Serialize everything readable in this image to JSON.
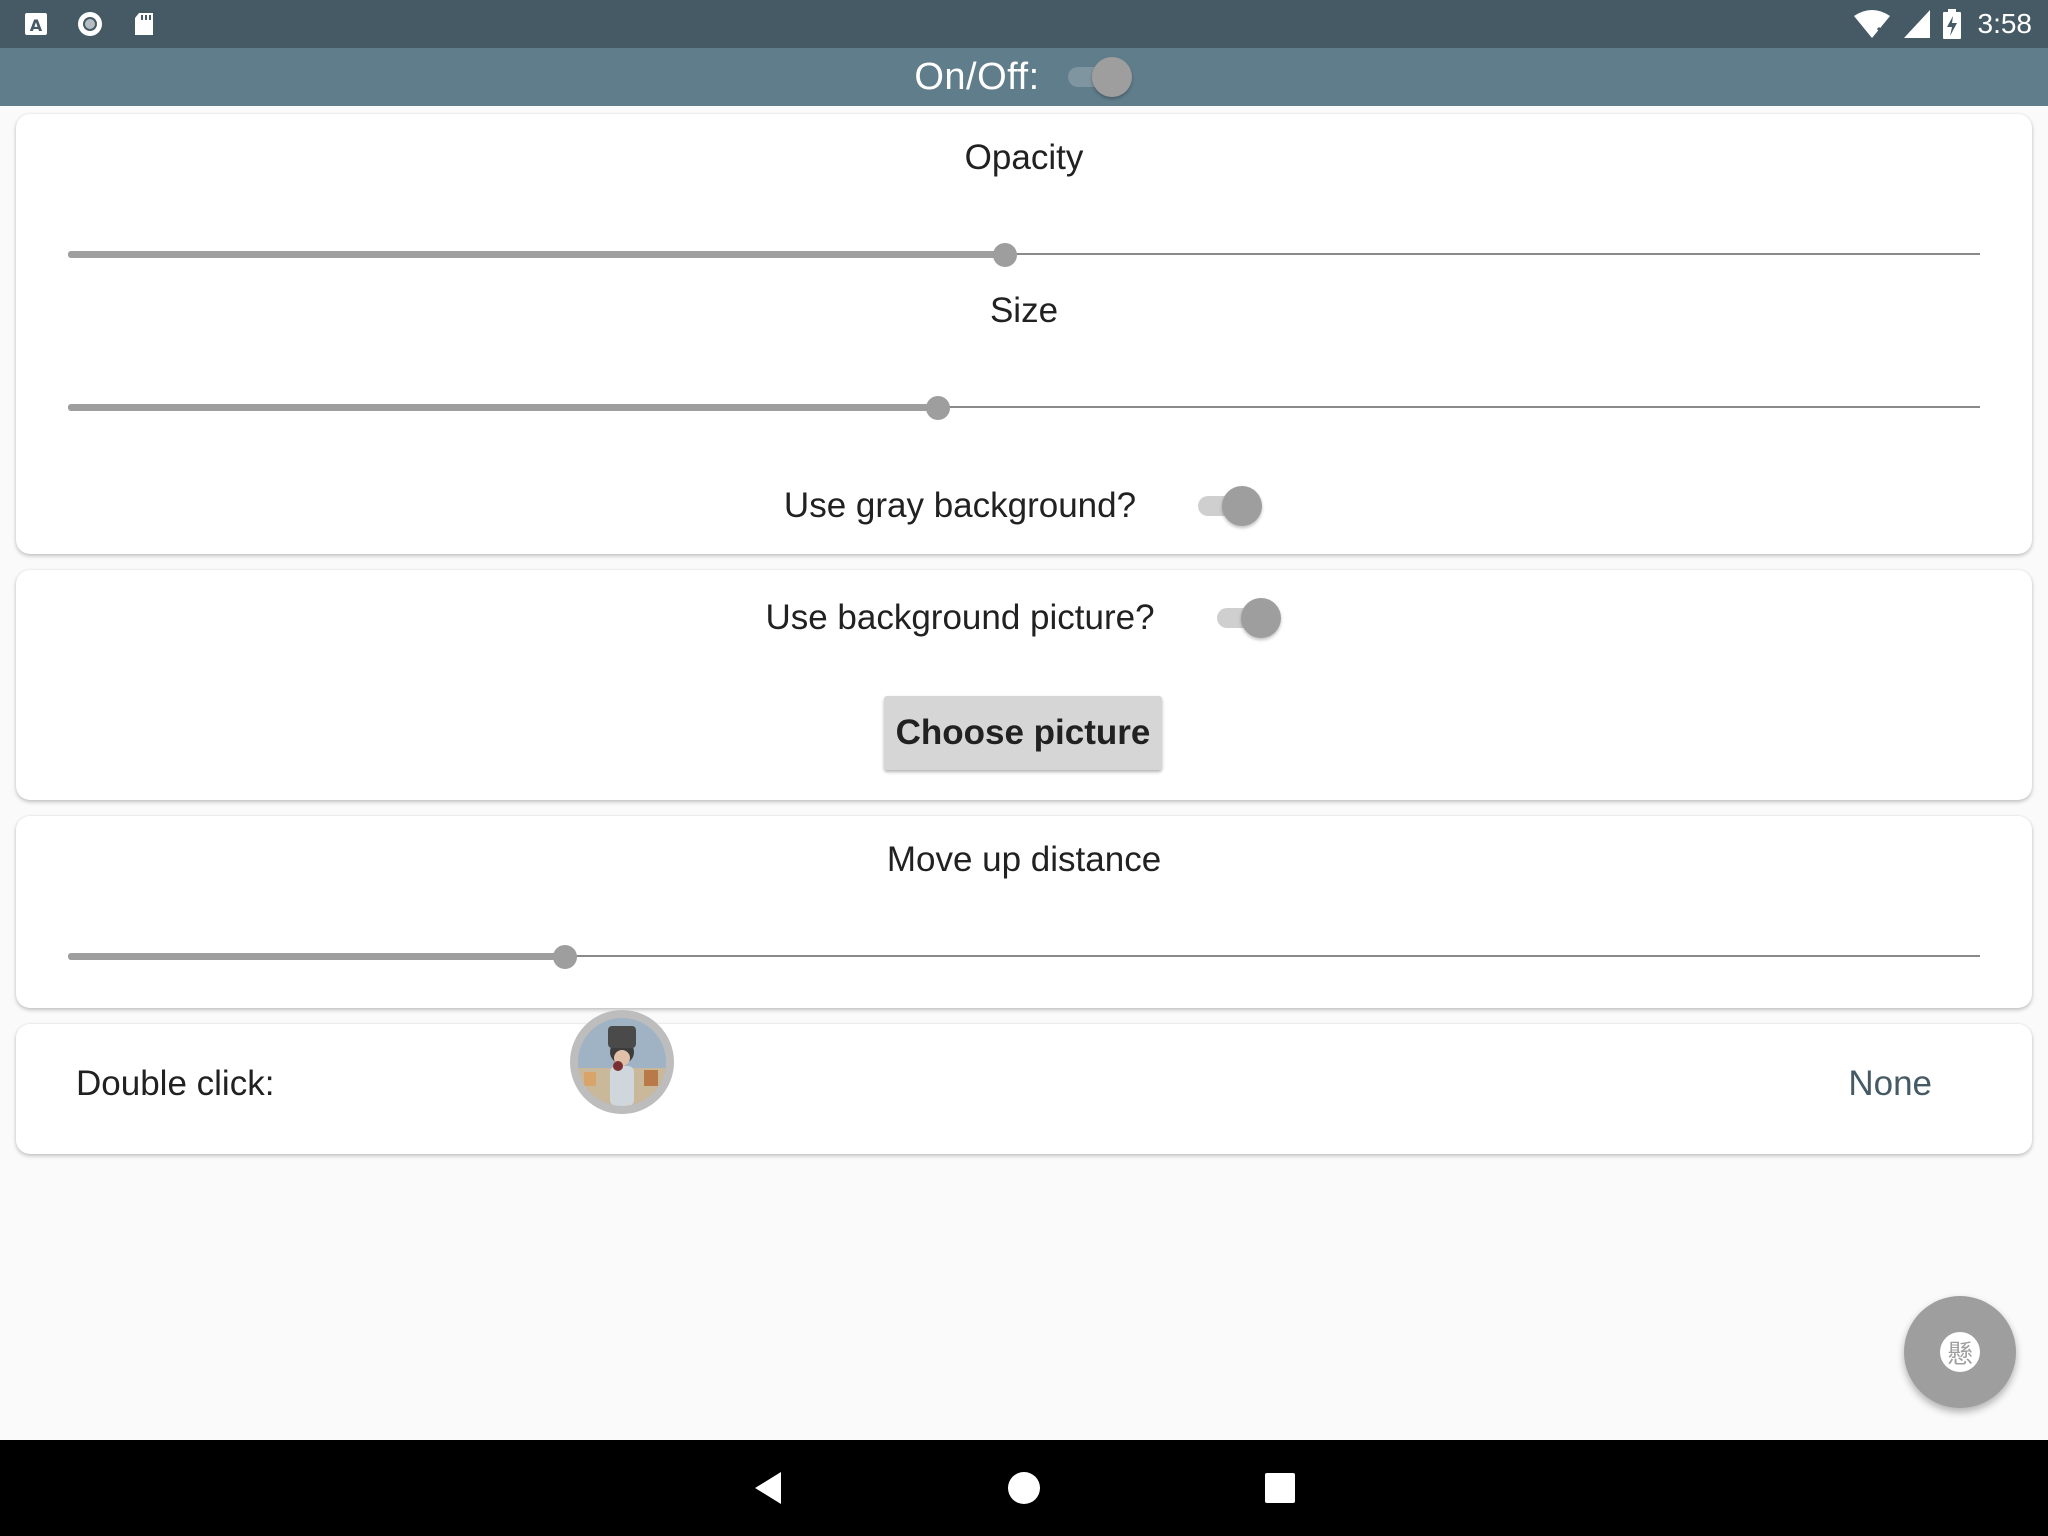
{
  "status_bar": {
    "time": "3:58",
    "left_icons": [
      "text-a-icon",
      "record-icon",
      "sd-card-icon"
    ],
    "right_icons": [
      "wifi-off-icon",
      "signal-icon",
      "battery-charging-icon"
    ]
  },
  "app_bar": {
    "title": "On/Off:",
    "switch_on": false
  },
  "appearance_card": {
    "opacity": {
      "label": "Opacity",
      "value_fraction": 0.49
    },
    "size": {
      "label": "Size",
      "value_fraction": 0.455
    },
    "gray_background": {
      "label": "Use gray background?",
      "on": false
    }
  },
  "background_card": {
    "background_picture": {
      "label": "Use background picture?",
      "on": false
    },
    "choose_button_label": "Choose picture"
  },
  "move_card": {
    "label": "Move up distance",
    "value_fraction": 0.26
  },
  "double_click_card": {
    "label": "Double click:",
    "value": "None"
  },
  "fab": {
    "glyph": "懸",
    "icon": "floating-window-icon"
  },
  "nav_bar": {
    "buttons": [
      "back-icon",
      "home-icon",
      "recents-icon"
    ]
  },
  "colors": {
    "status_bar": "#455a64",
    "app_bar": "#607d8b",
    "accent_gray": "#9e9e9e",
    "value_text": "#455a64"
  }
}
